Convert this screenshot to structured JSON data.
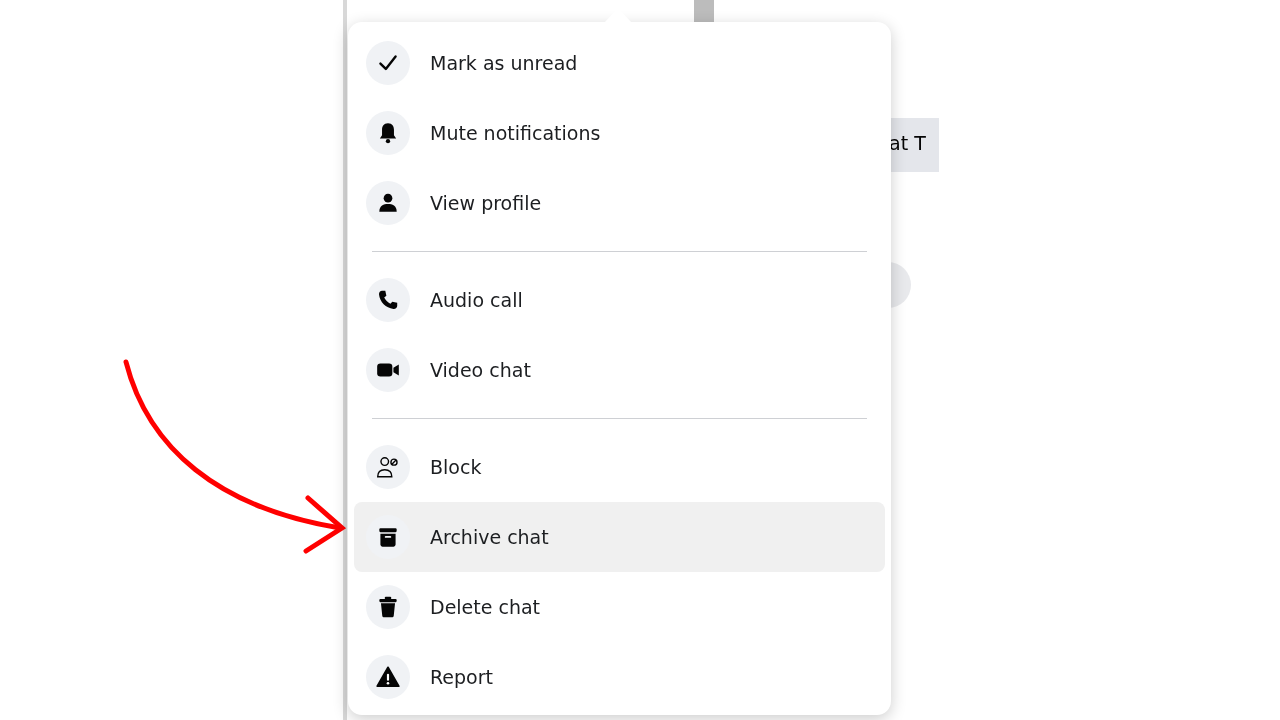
{
  "background_chat": {
    "message_fragment": "at T"
  },
  "context_menu": {
    "sections": [
      {
        "items": [
          {
            "label": "Mark as unread",
            "selected": false
          },
          {
            "label": "Mute notifications",
            "selected": false
          },
          {
            "label": "View profile",
            "selected": false
          }
        ]
      },
      {
        "items": [
          {
            "label": "Audio call",
            "selected": false
          },
          {
            "label": "Video chat",
            "selected": false
          }
        ]
      },
      {
        "items": [
          {
            "label": "Block",
            "selected": false
          },
          {
            "label": "Archive chat",
            "selected": true
          },
          {
            "label": "Delete chat",
            "selected": false
          },
          {
            "label": "Report",
            "selected": false
          }
        ]
      }
    ]
  }
}
